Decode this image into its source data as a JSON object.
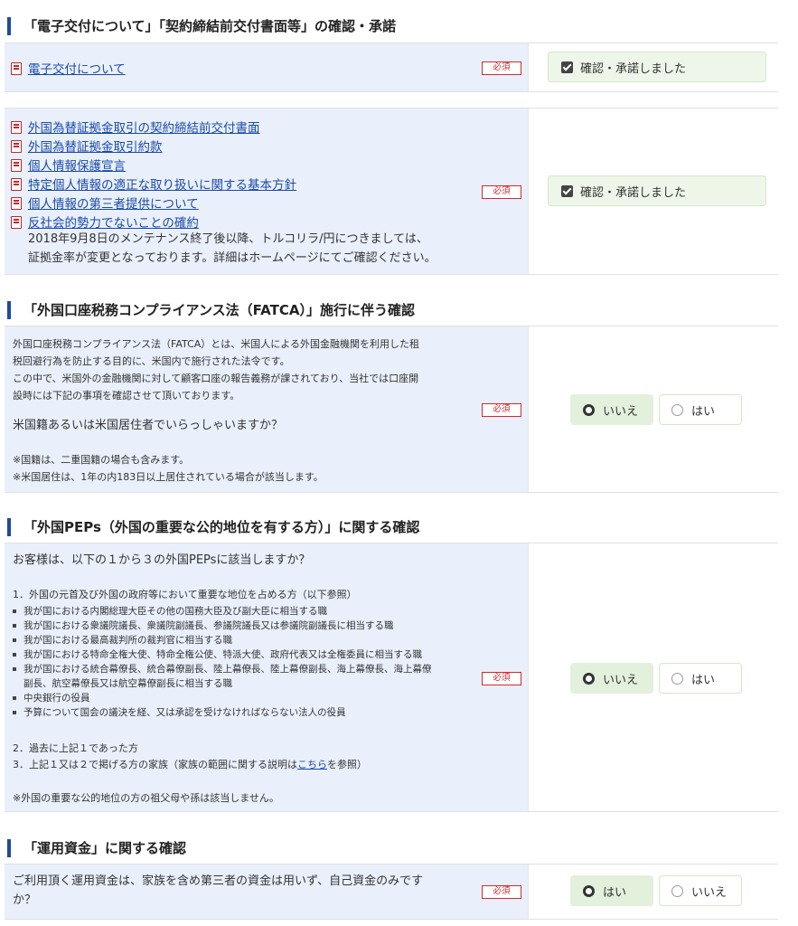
{
  "sections": {
    "s1": {
      "title": "「電子交付について」「契約締結前交付書面等」の確認・承諾",
      "row1": {
        "link": "電子交付について",
        "required": "必須",
        "confirm": "確認・承諾しました"
      },
      "row2": {
        "links": [
          "外国為替証拠金取引の契約締結前交付書面",
          "外国為替証拠金取引約款",
          "個人情報保護宣言",
          "特定個人情報の適正な取り扱いに関する基本方針",
          "個人情報の第三者提供について",
          "反社会的勢力でないことの確約"
        ],
        "note_line1": "2018年9月8日のメンテナンス終了後以降、トルコリラ/円につきましては、",
        "note_line2": "証拠金率が変更となっております。詳細はホームページにてご確認ください。",
        "required": "必須",
        "confirm": "確認・承諾しました"
      }
    },
    "s2": {
      "title": "「外国口座税務コンプライアンス法（FATCA）」施行に伴う確認",
      "desc_line1": "外国口座税務コンプライアンス法（FATCA）とは、米国人による外国金融機関を利用した租",
      "desc_line2": "税回避行為を防止する目的に、米国内で施行された法令です。",
      "desc_line3": "この中で、米国外の金融機関に対して顧客口座の報告義務が課されており、当社では口座開",
      "desc_line4": "設時には下記の事項を確認させて頂いております。",
      "question": "米国籍あるいは米国居住者でいらっしゃいますか？",
      "note1": "※国籍は、二重国籍の場合も含みます。",
      "note2": "※米国居住は、1年の内183日以上居住されている場合が該当します。",
      "required": "必須",
      "options": [
        "いいえ",
        "はい"
      ],
      "selected": "いいえ"
    },
    "s3": {
      "title": "「外国PEPs（外国の重要な公的地位を有する方）」に関する確認",
      "question": "お客様は、以下の１から３の外国PEPsに該当しますか？",
      "item1": "1．外国の元首及び外国の政府等において重要な地位を占める方（以下参照）",
      "bullets": [
        "我が国における内閣総理大臣その他の国務大臣及び副大臣に相当する職",
        "我が国における衆議院議長、衆議院副議長、参議院議長又は参議院副議長に相当する職",
        "我が国における最高裁判所の裁判官に相当する職",
        "我が国における特命全権大使、特命全権公使、特派大使、政府代表又は全権委員に相当する職",
        "我が国における統合幕僚長、統合幕僚副長、陸上幕僚長、陸上幕僚副長、海上幕僚長、海上幕僚",
        "中央銀行の役員",
        "予算について国会の議決を経、又は承認を受けなければならない法人の役員"
      ],
      "bullet5_cont": "副長、航空幕僚長又は航空幕僚副長に相当する職",
      "item2": "2．過去に上記１であった方",
      "item3_pre": "3．上記１又は２で掲げる方の家族（家族の範囲に関する説明は",
      "item3_link": "こちら",
      "item3_post": "を参照）",
      "note": "※外国の重要な公的地位の方の祖父母や孫は該当しません。",
      "required": "必須",
      "options": [
        "いいえ",
        "はい"
      ],
      "selected": "いいえ"
    },
    "s4": {
      "title": "「運用資金」に関する確認",
      "question_line1": "ご利用頂く運用資金は、家族を含め第三者の資金は用いず、自己資金のみです",
      "question_line2": "か？",
      "required": "必須",
      "options": [
        "はい",
        "いいえ"
      ],
      "selected": "はい"
    }
  }
}
